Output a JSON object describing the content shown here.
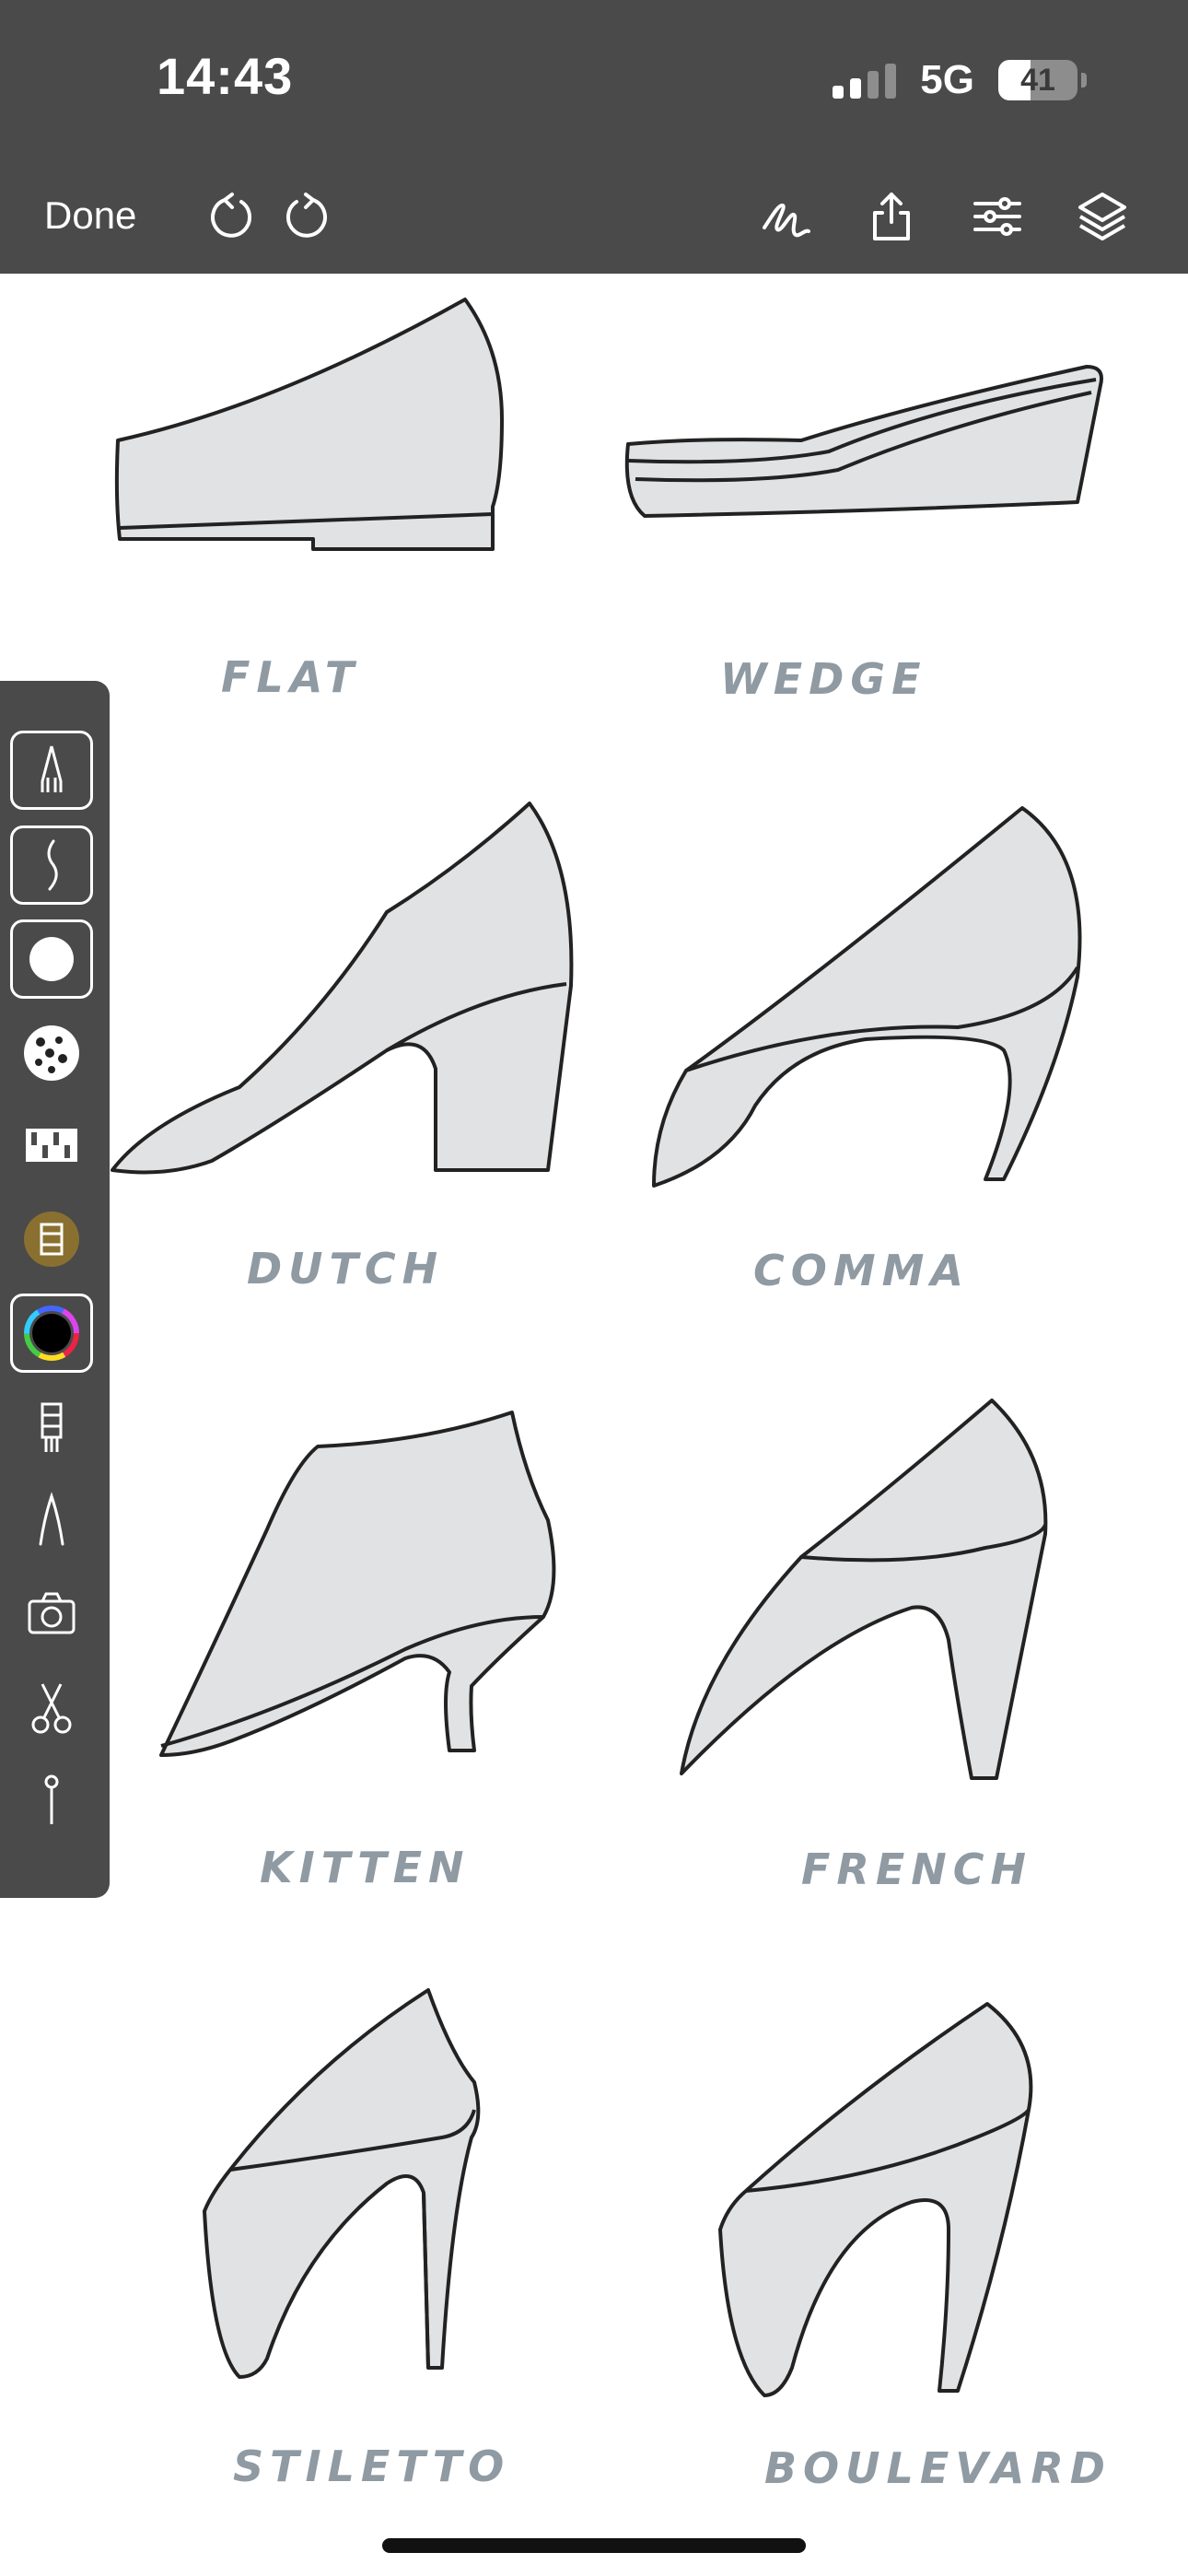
{
  "status_bar": {
    "time": "14:43",
    "network": "5G",
    "battery": "41"
  },
  "toolbar": {
    "done_label": "Done",
    "icons": [
      "undo-icon",
      "redo-icon",
      "brush-icon",
      "share-icon",
      "adjustments-icon",
      "layers-icon"
    ]
  },
  "palette": {
    "tools": [
      "pen-tool-icon",
      "stroke-curve-icon",
      "brush-size-icon",
      "texture-brush-icon",
      "pattern-icon",
      "fill-icon",
      "color-picker-icon",
      "ruler-icon",
      "nib-icon",
      "camera-icon",
      "scissors-icon",
      "pin-icon"
    ]
  },
  "canvas": {
    "labels": [
      "FLAT",
      "WEDGE",
      "DUTCH",
      "COMMA",
      "KITTEN",
      "FRENCH",
      "STILETTO",
      "BOULEVARD"
    ]
  },
  "colors": {
    "bar": "#4a4a4a",
    "label": "#8f9aa3",
    "shoe_fill": "#e1e2e3"
  }
}
